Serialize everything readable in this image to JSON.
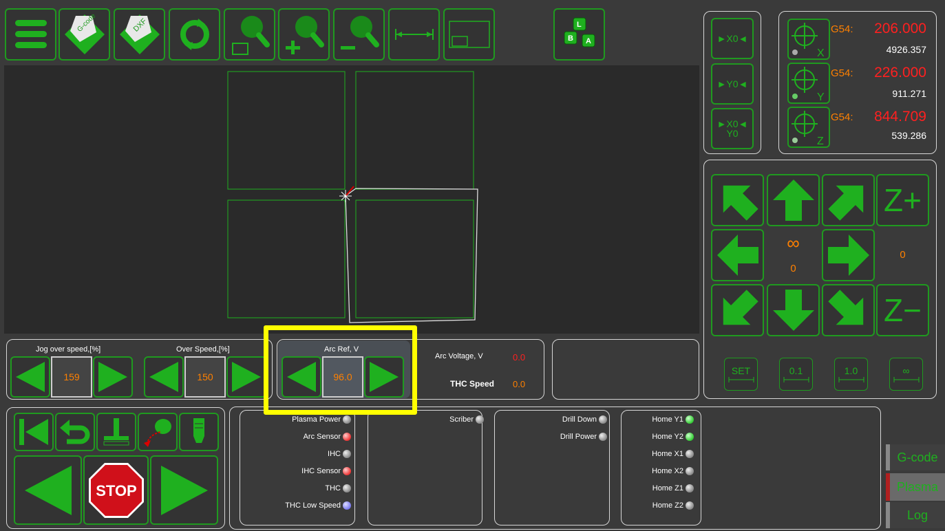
{
  "toolbar": {
    "menu_icon": "menu-icon",
    "gcode_label": "G-code",
    "dxf_label": "DXF",
    "keys": [
      "L",
      "B",
      "A"
    ]
  },
  "zero_buttons": {
    "x0": "►X0◄",
    "y0": "►Y0◄",
    "xy0_top": "►X0◄",
    "xy0_bottom": "Y0"
  },
  "coords": {
    "x": {
      "axis": "X",
      "prefix": "G54:",
      "work": "206.000",
      "machine": "4926.357"
    },
    "y": {
      "axis": "Y",
      "prefix": "G54:",
      "work": "226.000",
      "machine": "911.271"
    },
    "z": {
      "axis": "Z",
      "prefix": "G54:",
      "work": "844.709",
      "machine": "539.286"
    }
  },
  "jog": {
    "z_plus": "Z+",
    "z_minus": "Z−",
    "infinity": "∞",
    "center_value": "0",
    "right_value": "0",
    "steps": [
      "SET",
      "0.1",
      "1.0",
      "∞"
    ]
  },
  "speeds": {
    "jog_over_label": "Jog over speed,[%]",
    "jog_over_value": "159",
    "over_label": "Over Speed,[%]",
    "over_value": "150",
    "arc_ref_label": "Arc Ref, V",
    "arc_ref_value": "96.0",
    "arc_voltage_label": "Arc Voltage, V",
    "arc_voltage_value": "0.0",
    "thc_speed_label": "THC Speed",
    "thc_speed_value": "0.0"
  },
  "control": {
    "stop": "STOP"
  },
  "io": {
    "col1": [
      {
        "label": "Plasma Power",
        "state": "gray"
      },
      {
        "label": "Arc Sensor",
        "state": "red"
      },
      {
        "label": "IHC",
        "state": "gray"
      },
      {
        "label": "IHC Sensor",
        "state": "red"
      },
      {
        "label": "THC",
        "state": "gray"
      },
      {
        "label": "THC Low Speed",
        "state": "blue"
      }
    ],
    "col2": [
      {
        "label": "Scriber",
        "state": "gray"
      }
    ],
    "col3": [
      {
        "label": "Drill Down",
        "state": "gray"
      },
      {
        "label": "Drill Power",
        "state": "gray"
      }
    ],
    "col4": [
      {
        "label": "Home Y1",
        "state": "green"
      },
      {
        "label": "Home Y2",
        "state": "green"
      },
      {
        "label": "Home X1",
        "state": "gray"
      },
      {
        "label": "Home X2",
        "state": "gray"
      },
      {
        "label": "Home Z1",
        "state": "gray"
      },
      {
        "label": "Home Z2",
        "state": "gray"
      }
    ]
  },
  "tabs": [
    "G-code",
    "Plasma",
    "Log"
  ],
  "colors": {
    "accent": "#1f9a1f",
    "highlight": "#ffff00",
    "value_orange": "#ff8000",
    "value_red": "#ff2020"
  }
}
